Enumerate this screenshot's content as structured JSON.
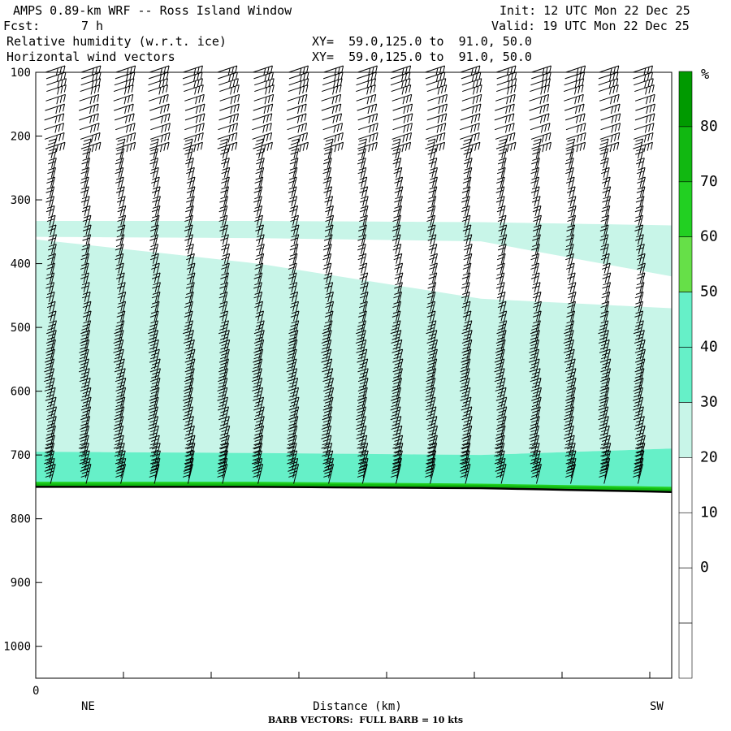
{
  "header": {
    "title": "AMPS 0.89-km WRF -- Ross Island Window",
    "init": "Init: 12 UTC Mon 22 Dec 25",
    "fcst_label": "Fcst:",
    "fcst_value": "7 h",
    "valid": "Valid: 19 UTC Mon 22 Dec 25",
    "field1": "Relative humidity (w.r.t. ice)",
    "field1_xy": "XY=  59.0,125.0 to  91.0, 50.0",
    "field2": "Horizontal wind vectors",
    "field2_xy": "XY=  59.0,125.0 to  91.0, 50.0"
  },
  "footer": "BARB VECTORS:  FULL BARB = 10 kts",
  "colors": {
    "rh_30_40": "#c8f5e8",
    "rh_40_50": "#66f0c8",
    "rh_60_70": "#66e048",
    "rh_70_80": "#22d022",
    "rh_80_90": "#11b811",
    "rh_90_100": "#009a00",
    "barb": "#000000",
    "terrain": "#000000"
  },
  "chart_data": {
    "type": "heatmap",
    "title": "Relative humidity (w.r.t. ice)",
    "overlay": "Horizontal wind vectors",
    "xlabel": "Distance (km)",
    "x_start_label": "0",
    "x_end_labels": [
      "NE",
      "SW"
    ],
    "ylabel": "",
    "y_ticks": [
      "100",
      "200",
      "300",
      "400",
      "500",
      "600",
      "700",
      "800",
      "900",
      "1000"
    ],
    "ylim": [
      100,
      1050
    ],
    "y_inverted": true,
    "colorbar": {
      "unit": "%",
      "labels": [
        "80",
        "70",
        "60",
        "50",
        "40",
        "30",
        "20",
        "10",
        "0"
      ],
      "bins": [
        {
          "from": 90,
          "to": 100,
          "color": "#009a00"
        },
        {
          "from": 80,
          "to": 90,
          "color": "#11b811"
        },
        {
          "from": 70,
          "to": 80,
          "color": "#22d022"
        },
        {
          "from": 60,
          "to": 70,
          "color": "#66e048"
        },
        {
          "from": 50,
          "to": 60,
          "color": "#66f0c8"
        },
        {
          "from": 40,
          "to": 50,
          "color": "#66f0c8"
        },
        {
          "from": 30,
          "to": 40,
          "color": "#c8f5e8"
        },
        {
          "from": 20,
          "to": 30,
          "color": "#ffffff"
        },
        {
          "from": 10,
          "to": 20,
          "color": "#ffffff"
        },
        {
          "from": 0,
          "to": 10,
          "color": "#ffffff"
        },
        {
          "from": -10,
          "to": 0,
          "color": "#ffffff"
        }
      ]
    },
    "rh_regions": [
      {
        "name": "upper-moist-layer",
        "class": "30-40",
        "top_hPa": [
          333,
          333,
          335,
          340
        ],
        "bottom_hPa": [
          358,
          360,
          365,
          420
        ]
      },
      {
        "name": "mid-moist-layer",
        "class": "30-40",
        "top_hPa": [
          362,
          400,
          455,
          470
        ],
        "bottom_hPa": [
          700,
          700,
          700,
          690
        ]
      },
      {
        "name": "low-moist-layer",
        "class": "40-50",
        "top_hPa": [
          695,
          697,
          700,
          690
        ],
        "bottom_hPa": [
          748,
          748,
          750,
          755
        ]
      },
      {
        "name": "surface-moist-layer",
        "class": "60-90",
        "top_hPa": [
          742,
          742,
          745,
          750
        ],
        "bottom_hPa": [
          750,
          750,
          752,
          758
        ]
      }
    ],
    "rh_region_x_fraction": [
      0,
      0.35,
      0.7,
      1
    ],
    "terrain_hPa": [
      750,
      750,
      752,
      758
    ],
    "barb_columns": 18,
    "barb_levels_hPa": [
      100,
      110,
      120,
      130,
      145,
      160,
      175,
      190,
      205,
      220,
      235,
      250,
      265,
      280,
      295,
      310,
      325,
      340,
      355,
      370,
      385,
      400,
      415,
      430,
      445,
      460,
      475,
      490,
      505,
      520,
      535,
      550,
      565,
      580,
      595,
      610,
      625,
      640,
      655,
      670,
      685,
      700,
      712,
      724,
      736,
      745
    ]
  }
}
